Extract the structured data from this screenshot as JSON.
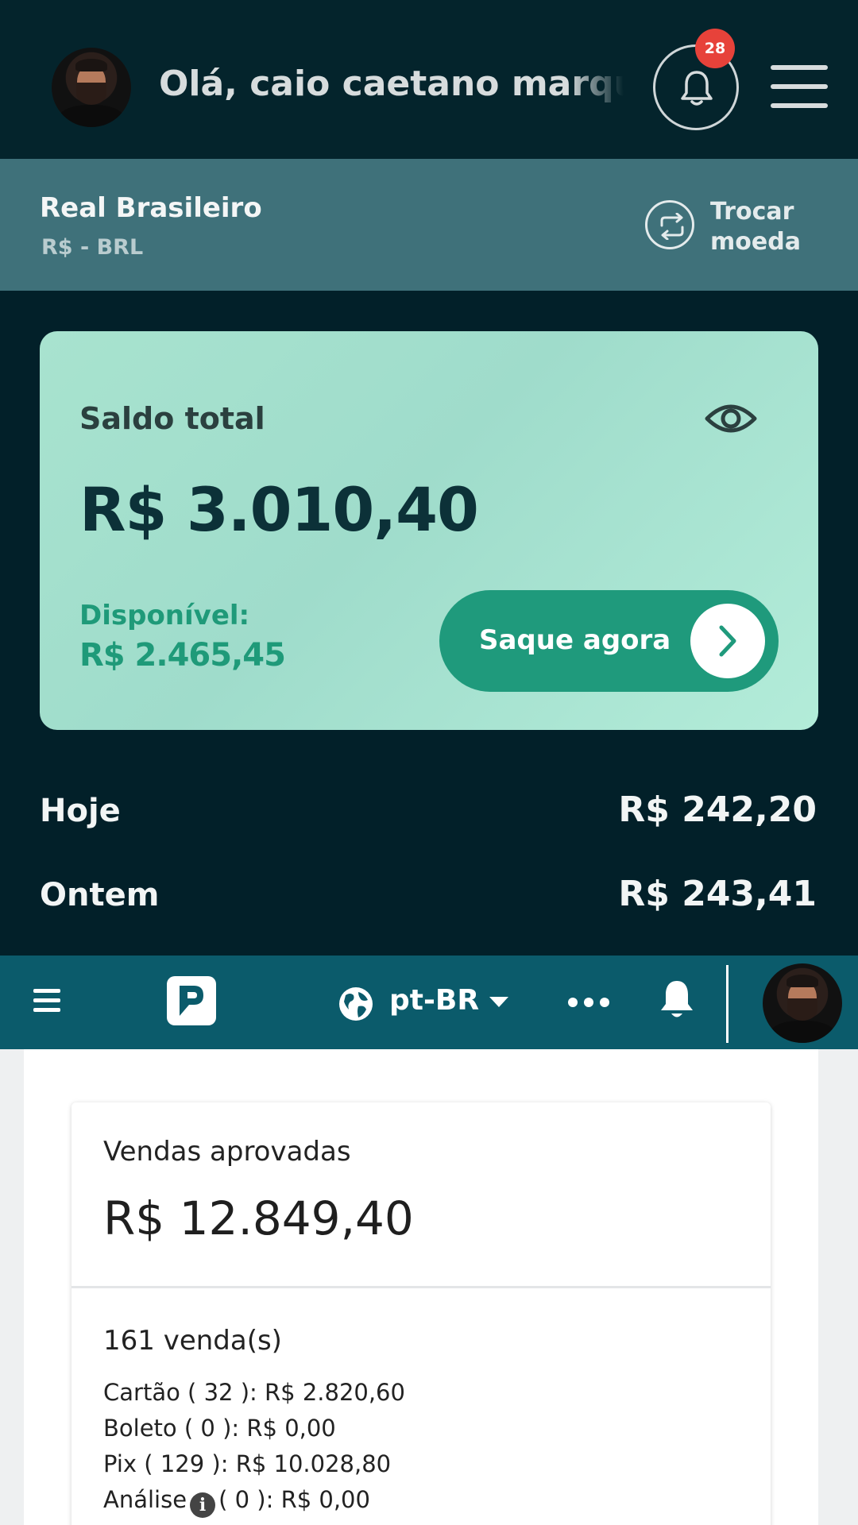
{
  "header": {
    "greeting": "Olá, caio caetano marques",
    "notification_count": "28"
  },
  "currency": {
    "name": "Real Brasileiro",
    "code": "R$ - BRL",
    "swap_label": "Trocar moeda"
  },
  "balance": {
    "label": "Saldo total",
    "total": "R$ 3.010,40",
    "available_label": "Disponível:",
    "available_value": "R$ 2.465,45",
    "withdraw_label": "Saque agora"
  },
  "summary": {
    "today_label": "Hoje",
    "today_value": "R$ 242,20",
    "yesterday_label": "Ontem",
    "yesterday_value": "R$ 243,41"
  },
  "nav2": {
    "language": "pt-BR"
  },
  "sales": {
    "title": "Vendas aprovadas",
    "total": "R$ 12.849,40",
    "count": "161 venda(s)",
    "card": "Cartão ( 32 ): R$ 2.820,60",
    "boleto": "Boleto ( 0 ): R$ 0,00",
    "pix": "Pix ( 129 ): R$ 10.028,80",
    "analysis_label": "Análise",
    "analysis_value": "( 0 ): R$ 0,00"
  },
  "colors": {
    "header_bg": "#04242c",
    "currency_bg": "#3f717a",
    "accent_green": "#1f9a7c",
    "nav2_bg": "#0b5b6b",
    "badge_red": "#e7423a"
  },
  "icons": [
    "bell-icon",
    "menu-icon",
    "swap-icon",
    "eye-icon",
    "chevron-right-icon",
    "globe-icon",
    "more-icon",
    "logo-icon",
    "info-icon"
  ]
}
